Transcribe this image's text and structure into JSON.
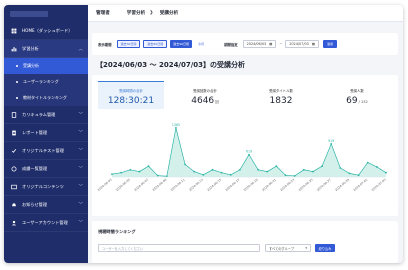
{
  "sidebar": {
    "home": "HOME（ダッシュボード）",
    "learning": "学習分析",
    "sub_items": [
      "受講分析",
      "ユーザーランキング",
      "教材タイトルランキング"
    ],
    "items": [
      {
        "label": "カリキュラム管理",
        "icon": "book-icon"
      },
      {
        "label": "レポート管理",
        "icon": "report-icon"
      },
      {
        "label": "オリジナルテスト管理",
        "icon": "test-icon"
      },
      {
        "label": "成績一覧管理",
        "icon": "grades-icon"
      },
      {
        "label": "オリジナルコンテンツ",
        "icon": "content-icon"
      },
      {
        "label": "お知らせ管理",
        "icon": "bell-icon"
      },
      {
        "label": "ユーザーアカウント管理",
        "icon": "user-icon"
      }
    ]
  },
  "breadcrumb": {
    "root": "管理者",
    "parent": "学習分析",
    "current": "受講分析"
  },
  "filter": {
    "label": "表示期間",
    "presets": [
      "過去30日間",
      "過去60日間",
      "過去90日間"
    ],
    "active_preset": "過去30日間",
    "this_month": "今月",
    "range_label": "期間指定",
    "date_from": "2024/06/03",
    "date_to": "2024/07/03",
    "apply": "適用"
  },
  "heading": "【2024/06/03 ～ 2024/07/03】の受講分析",
  "stats": [
    {
      "title": "受講時間の合計",
      "value": "128:30:21",
      "unit": ""
    },
    {
      "title": "受講回数の合計",
      "value": "4646",
      "unit": "回"
    },
    {
      "title": "受講タイトル数",
      "value": "1832",
      "unit": ""
    },
    {
      "title": "受講人数",
      "value": "69",
      "unit": "/ 132"
    }
  ],
  "chart_data": {
    "type": "area",
    "x": [
      "2024-06-03",
      "2024-06-04",
      "2024-06-05",
      "2024-06-06",
      "2024-06-07",
      "2024-06-08",
      "2024-06-09",
      "2024-06-10",
      "2024-06-11",
      "2024-06-12",
      "2024-06-13",
      "2024-06-14",
      "2024-06-15",
      "2024-06-16",
      "2024-06-17",
      "2024-06-18",
      "2024-06-19",
      "2024-06-20",
      "2024-06-21",
      "2024-06-22",
      "2024-06-23",
      "2024-06-24",
      "2024-06-25",
      "2024-06-26",
      "2024-06-27",
      "2024-06-28",
      "2024-06-29",
      "2024-06-30",
      "2024-07-01",
      "2024-07-02",
      "2024-07-03"
    ],
    "tick_labels": [
      "2024-06-03",
      "2024-06-05",
      "2024-06-07",
      "2024-06-09",
      "2024-06-11",
      "2024-06-13",
      "2024-06-15",
      "2024-06-17",
      "2024-06-19",
      "2024-06-21",
      "2024-06-23",
      "2024-06-25",
      "2024-06-27",
      "2024-06-29",
      "2024-07-01",
      "2024-07-03"
    ],
    "values": [
      80,
      120,
      200,
      150,
      300,
      40,
      20,
      1365,
      350,
      150,
      60,
      200,
      120,
      60,
      200,
      619,
      200,
      150,
      300,
      50,
      30,
      200,
      150,
      300,
      919,
      250,
      100,
      50,
      400,
      280,
      120
    ],
    "labeled_points": [
      [
        7,
        "1365"
      ],
      [
        15,
        "619"
      ],
      [
        24,
        "919"
      ]
    ],
    "ylim": [
      0,
      1500
    ],
    "color": "#2bb5a5",
    "fill": "#c9ece6"
  },
  "ranking": {
    "title": "視聴時間ランキング",
    "search_placeholder": "ユーザーを入力してください",
    "select_value": "すべてのグループ",
    "button": "絞り込み"
  }
}
